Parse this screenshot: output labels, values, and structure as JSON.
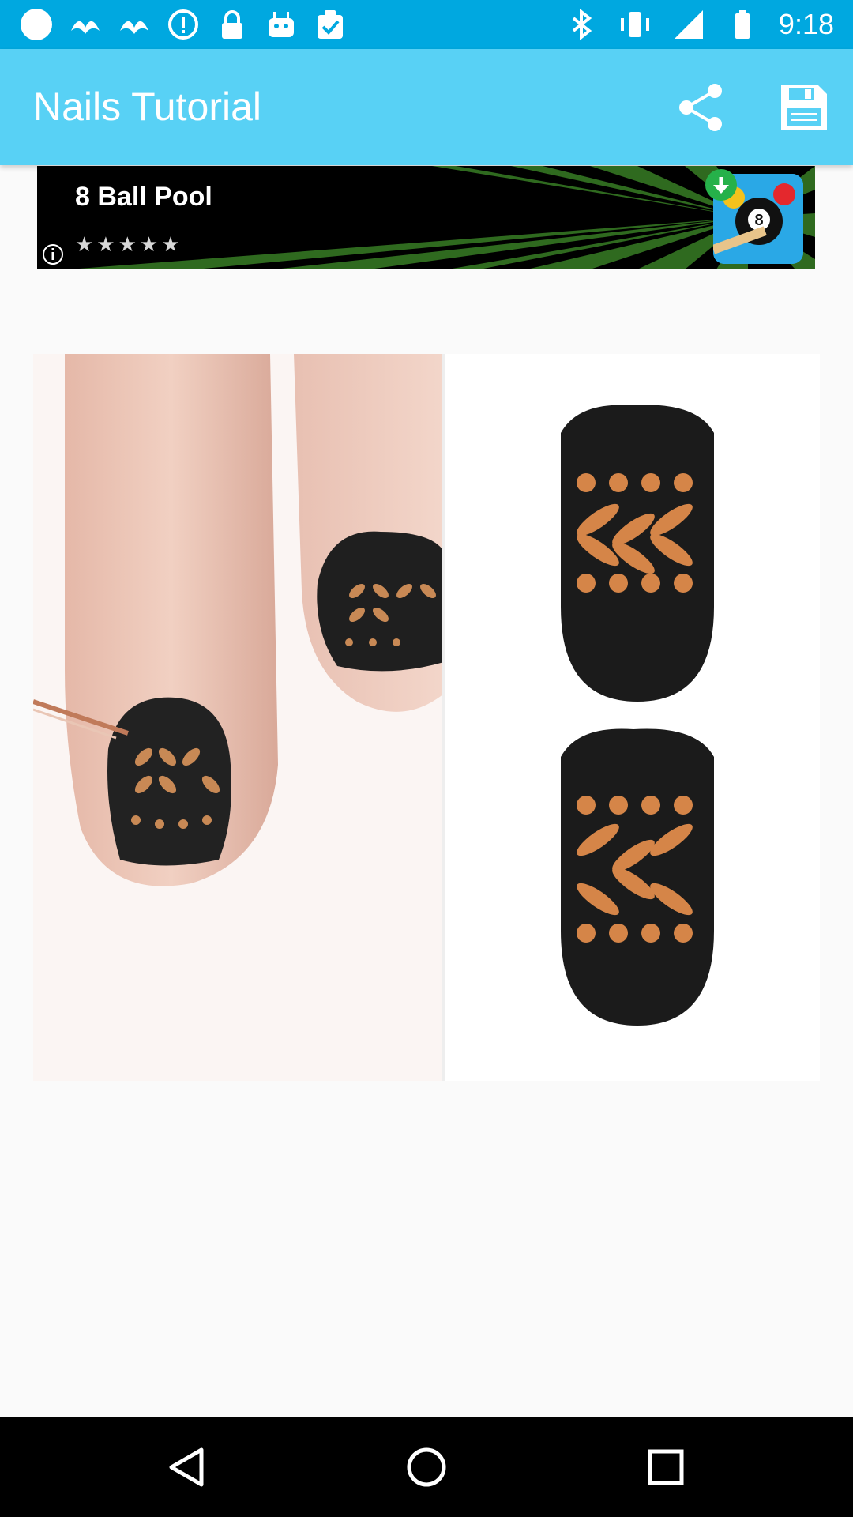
{
  "status_bar": {
    "time": "9:18",
    "left_icons": [
      "notification-circle-icon",
      "bird-icon",
      "bird-icon",
      "alert-icon",
      "lock-icon",
      "android-icon",
      "clipboard-check-icon"
    ],
    "right_icons": [
      "bluetooth-icon",
      "vibrate-icon",
      "signal-icon",
      "battery-icon"
    ]
  },
  "app_bar": {
    "title": "Nails Tutorial",
    "share_icon": "share-icon",
    "save_icon": "save-icon",
    "color": "#58d1f5"
  },
  "ad": {
    "title": "8 Ball Pool",
    "rating_stars": "★★★★★",
    "info_icon": "info-icon",
    "download_icon": "download-arrow-icon"
  },
  "content": {
    "image": "nail-art-tutorial-image"
  },
  "nav_bar": {
    "back_icon": "back-triangle-icon",
    "home_icon": "home-circle-icon",
    "recents_icon": "recents-square-icon"
  }
}
